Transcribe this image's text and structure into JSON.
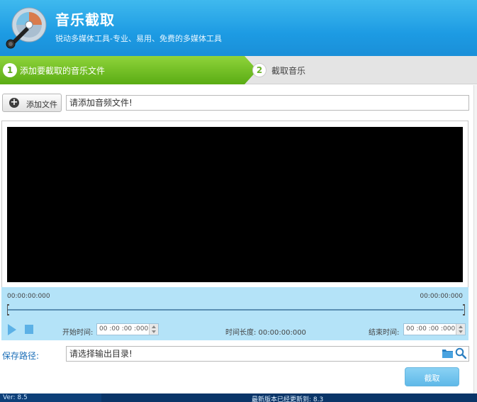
{
  "app": {
    "title": "音乐截取",
    "subtitle": "锐动多媒体工具-专业、易用、免费的多媒体工具"
  },
  "steps": [
    {
      "number": "1",
      "label": "添加要截取的音乐文件"
    },
    {
      "number": "2",
      "label": "截取音乐"
    }
  ],
  "add_file": {
    "button_label": "添加文件",
    "input_value": "请添加音频文件!"
  },
  "timeline": {
    "time_left": "00:00:00:000",
    "time_right": "00:00:00:000",
    "start_label": "开始时间:",
    "start_value": "00 :00 :00 :000",
    "duration_label": "时间长度: 00:00:00:000",
    "end_label": "结束时间:",
    "end_value": "00 :00 :00 :000"
  },
  "save": {
    "label": "保存路径:",
    "input_value": "请选择输出目录!"
  },
  "cut_button_label": "截取",
  "status": {
    "version": "Ver: 8.5",
    "notice": "最新版本已经更新到: 8.3"
  },
  "colors": {
    "header": "#1d9be3",
    "active_step": "#6bbf1e",
    "timeline_bg": "#b4e3f8",
    "status_bar": "#0d3f78"
  }
}
